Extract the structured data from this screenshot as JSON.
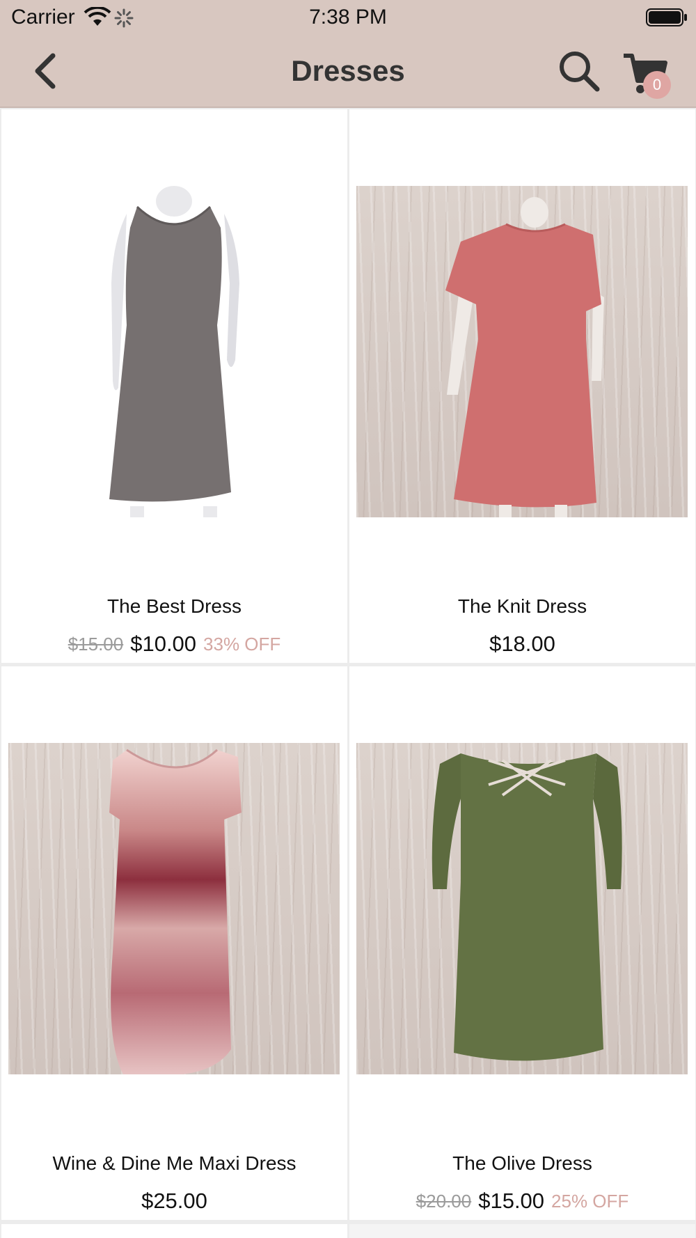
{
  "status_bar": {
    "carrier": "Carrier",
    "time": "7:38 PM"
  },
  "nav": {
    "title": "Dresses",
    "cart_count": "0",
    "icons": [
      "back-chevron-icon",
      "search-icon",
      "cart-icon"
    ]
  },
  "colors": {
    "header_bg": "#d8c7c0",
    "badge_bg": "#dfa6a3",
    "discount_text": "#d4a6a1"
  },
  "products": [
    {
      "name": "The Best Dress",
      "old_price": "$15.00",
      "price": "$10.00",
      "discount": "33% OFF"
    },
    {
      "name": "The Knit Dress",
      "old_price": "",
      "price": "$18.00",
      "discount": ""
    },
    {
      "name": "Wine & Dine Me Maxi Dress",
      "old_price": "",
      "price": "$25.00",
      "discount": ""
    },
    {
      "name": "The Olive Dress",
      "old_price": "$20.00",
      "price": "$15.00",
      "discount": "25% OFF"
    }
  ]
}
